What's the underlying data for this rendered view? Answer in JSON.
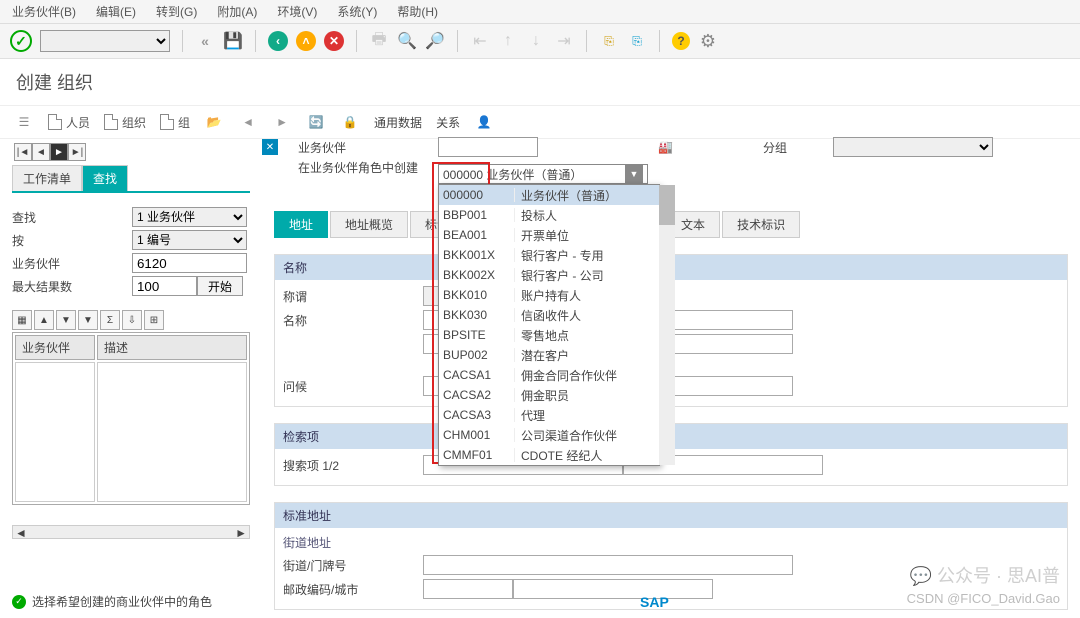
{
  "menu": {
    "items": [
      "业务伙伴(B)",
      "编辑(E)",
      "转到(G)",
      "附加(A)",
      "环境(V)",
      "系统(Y)",
      "帮助(H)"
    ]
  },
  "title": "创建 组织",
  "toolbar2": {
    "person": "人员",
    "org": "组织",
    "group": "组",
    "general": "通用数据",
    "relation": "关系"
  },
  "left": {
    "tabs": {
      "worklist": "工作清单",
      "search": "查找"
    },
    "search_label": "查找",
    "search_value": "1 业务伙伴",
    "by_label": "按",
    "by_value": "1 编号",
    "bp_label": "业务伙伴",
    "bp_value": "6120",
    "max_label": "最大结果数",
    "max_value": "100",
    "start_btn": "开始",
    "col1": "业务伙伴",
    "col2": "描述"
  },
  "right_header": {
    "bp": "业务伙伴",
    "create_in": "在业务伙伴角色中创建",
    "group": "分组",
    "selected_code": "000000",
    "selected_desc": "业务伙伴（普通）"
  },
  "tabs2": {
    "address": "地址",
    "overview": "地址概览",
    "ident": "标识",
    "text": "文本",
    "tech": "技术标识"
  },
  "group_name": {
    "header": "名称",
    "title_lbl": "称谓",
    "name_lbl": "名称",
    "greet_lbl": "问候"
  },
  "group_search": {
    "header": "检索项",
    "term_lbl": "搜索项 1/2"
  },
  "group_addr": {
    "header": "标准地址",
    "street_hdr": "街道地址",
    "street_lbl": "街道/门牌号",
    "postal_lbl": "邮政编码/城市"
  },
  "dropdown": [
    {
      "code": "000000",
      "desc": "业务伙伴（普通）"
    },
    {
      "code": "BBP001",
      "desc": "投标人"
    },
    {
      "code": "BEA001",
      "desc": "开票单位"
    },
    {
      "code": "BKK001X",
      "desc": "银行客户 - 专用"
    },
    {
      "code": "BKK002X",
      "desc": "银行客户 - 公司"
    },
    {
      "code": "BKK010",
      "desc": "账户持有人"
    },
    {
      "code": "BKK030",
      "desc": "信函收件人"
    },
    {
      "code": "BPSITE",
      "desc": "零售地点"
    },
    {
      "code": "BUP002",
      "desc": "潜在客户"
    },
    {
      "code": "CACSA1",
      "desc": "佣金合同合作伙伴"
    },
    {
      "code": "CACSA2",
      "desc": "佣金职员"
    },
    {
      "code": "CACSA3",
      "desc": "代理"
    },
    {
      "code": "CHM001",
      "desc": "公司渠道合作伙伴"
    },
    {
      "code": "CMMF01",
      "desc": "CDOTE 经纪人"
    }
  ],
  "status": "选择希望创建的商业伙伴中的角色",
  "sap": "SAP",
  "wm1": "公众号 · 思AI普",
  "wm2": "CSDN @FICO_David.Gao"
}
